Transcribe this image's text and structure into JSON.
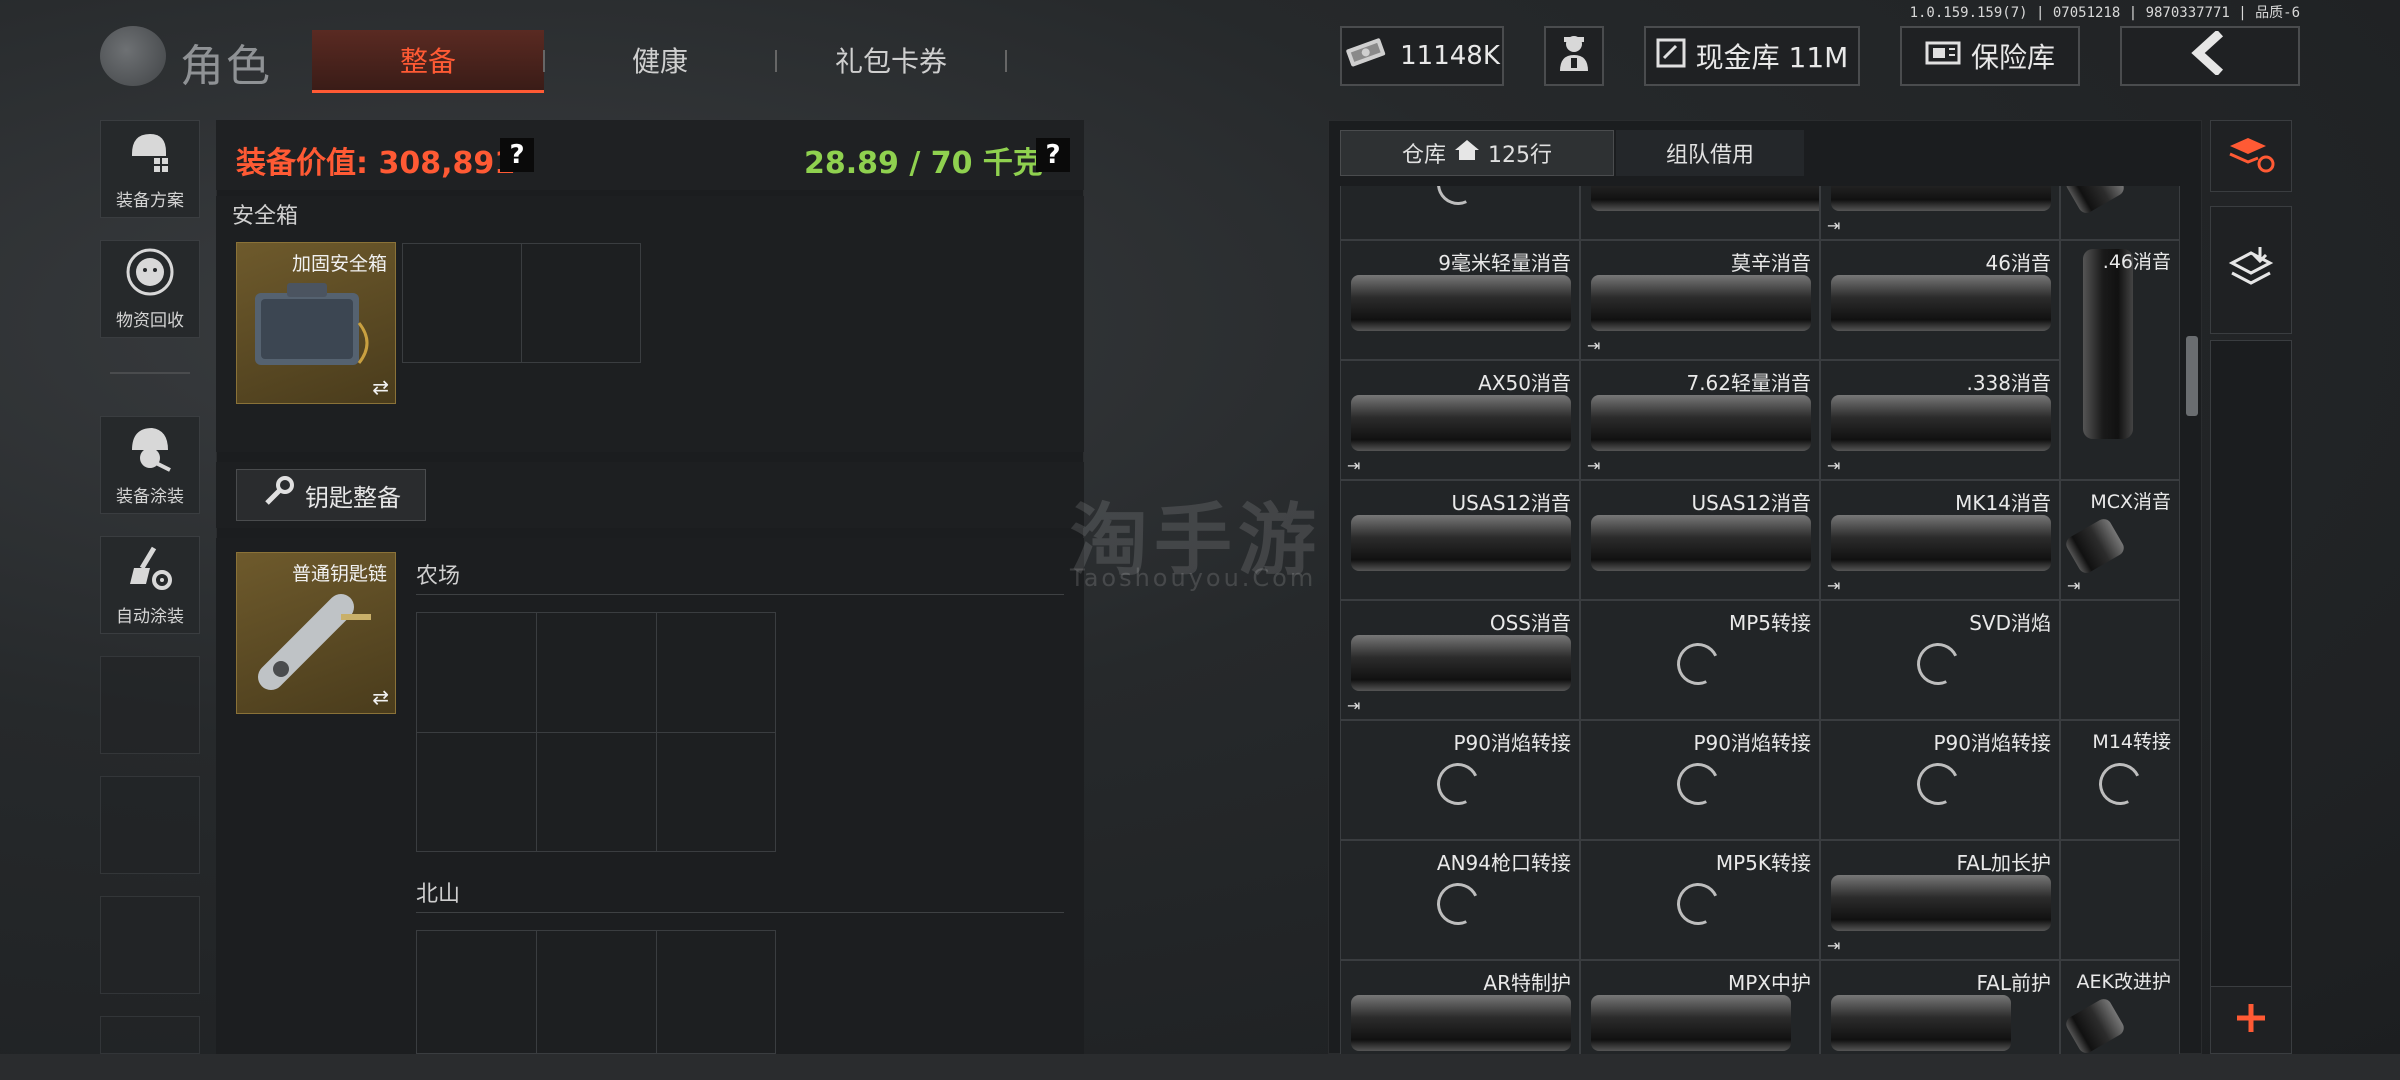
{
  "version": "1.0.159.159(7) | 07051218 | 9870337771 | 品质-6",
  "header": {
    "title": "角色",
    "tabs": [
      {
        "label": "整备",
        "active": true
      },
      {
        "label": "健康",
        "active": false
      },
      {
        "label": "礼包卡券",
        "active": false
      }
    ],
    "money": "11148K",
    "cash_vault_label": "现金库 11M",
    "insurance_label": "保险库"
  },
  "sidebar": {
    "items": [
      {
        "label": "装备方案",
        "icon": "helmet-grid-icon"
      },
      {
        "label": "物资回收",
        "icon": "recycle-icon"
      },
      {
        "label": "装备涂装",
        "icon": "helmet-paint-icon"
      },
      {
        "label": "自动涂装",
        "icon": "brush-gear-icon"
      }
    ]
  },
  "loadout": {
    "gear_value_label": "装备价值: 308,891",
    "weight_label": "28.89 / 70 千克",
    "help_glyph": "?",
    "safe_box_section": "安全箱",
    "safe_box_item": "加固安全箱",
    "key_button_label": "钥匙整备",
    "keychain_item": "普通钥匙链",
    "key_sections": [
      "农场",
      "北山"
    ],
    "swap_glyph": "⇄"
  },
  "warehouse": {
    "tab_warehouse": "仓库",
    "tab_rows": "125行",
    "tab_team": "组队借用",
    "rows": [
      [
        "",
        "",
        "",
        ""
      ],
      [
        "9毫米轻量消音",
        "莫辛消音",
        "46消音",
        ".46消音"
      ],
      [
        "AX50消音",
        "7.62轻量消音",
        ".338消音",
        ""
      ],
      [
        "USAS12消音",
        "USAS12消音",
        "MK14消音",
        "MCX消音"
      ],
      [
        "OSS消音",
        "MP5转接",
        "SVD消焰",
        ""
      ],
      [
        "P90消焰转接",
        "P90消焰转接",
        "P90消焰转接",
        "M14转接"
      ],
      [
        "AN94枪口转接",
        "MP5K转接",
        "FAL加长护",
        ""
      ],
      [
        "AR特制护",
        "MPX中护",
        "FAL前护",
        "AEK改进护"
      ]
    ]
  },
  "watermark": {
    "main": "淘手游",
    "sub": "Taoshouyou.Com"
  },
  "colors": {
    "accent": "#ff5a34",
    "weight_green": "#8fd14f",
    "item_gold": "#6e5a2c"
  }
}
